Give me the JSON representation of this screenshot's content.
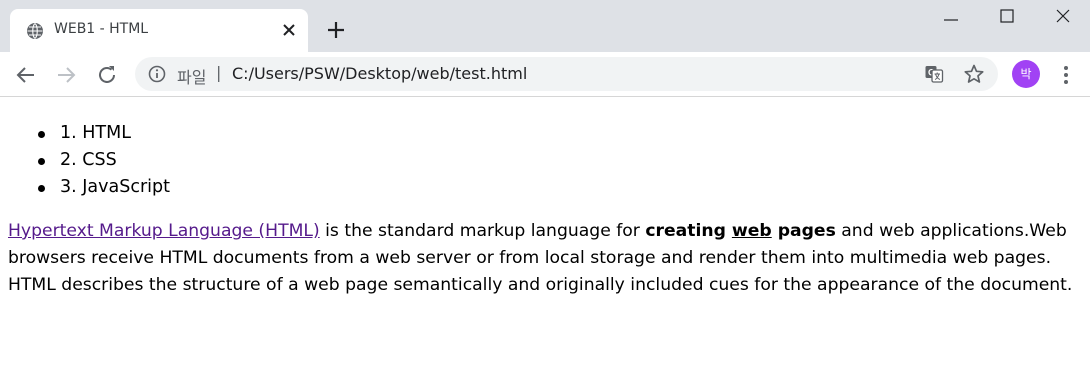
{
  "browser": {
    "tab": {
      "title": "WEB1 - HTML"
    },
    "omnibox": {
      "scheme_label": "파일",
      "separator": "|",
      "url": "C:/Users/PSW/Desktop/web/test.html"
    },
    "profile": {
      "initial": "박",
      "color": "#a142f4"
    }
  },
  "page": {
    "list": [
      {
        "text": "1. HTML"
      },
      {
        "text": "2. CSS"
      },
      {
        "text": "3. JavaScript"
      }
    ],
    "paragraph": {
      "link_text": "Hypertext Markup Language (HTML)",
      "text_1": " is the standard markup language for ",
      "bold_1": "creating ",
      "bold_underlined": "web",
      "bold_2": " pages",
      "text_2": " and web applications.Web browsers receive HTML documents from a web server or from local storage and render them into multimedia web pages. HTML describes the structure of a web page semantically and originally included cues for the appearance of the document."
    }
  },
  "colors": {
    "titlebar_bg": "#dee1e6",
    "omnibox_bg": "#f1f3f4",
    "visited_link": "#551a8b"
  },
  "icons": {
    "tab_favicon": "globe-icon",
    "tab_close": "close-icon",
    "new_tab": "plus-icon",
    "back": "arrow-left-icon",
    "forward": "arrow-right-icon",
    "reload": "reload-icon",
    "site_info": "info-icon",
    "translate": "translate-icon",
    "bookmark": "star-icon",
    "menu": "kebab-menu-icon"
  }
}
